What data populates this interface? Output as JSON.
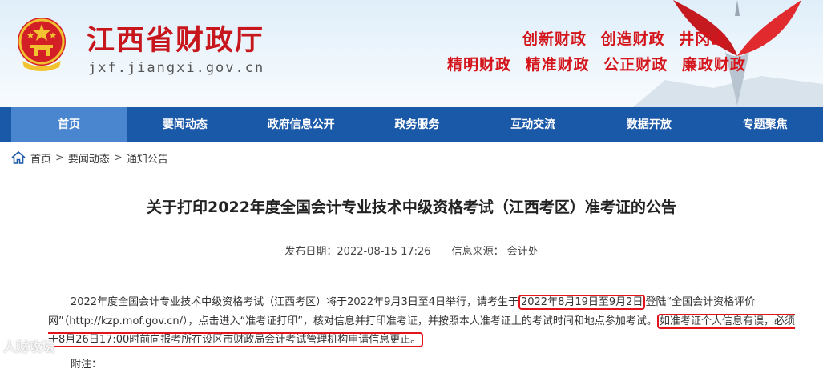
{
  "header": {
    "site_title": "江西省财政厅",
    "site_domain": "jxf.jiangxi.gov.cn",
    "slogans_row1": [
      "创新财政",
      "创造财政",
      "井冈山"
    ],
    "slogans_row2": [
      "精明财政",
      "精准财政",
      "公正财政",
      "廉政财政"
    ]
  },
  "nav": {
    "items": [
      {
        "label": "首页",
        "active": true
      },
      {
        "label": "要闻动态"
      },
      {
        "label": "政府信息公开"
      },
      {
        "label": "政务服务"
      },
      {
        "label": "互动交流"
      },
      {
        "label": "数据开放"
      },
      {
        "label": "专题聚焦"
      }
    ]
  },
  "breadcrumb": {
    "items": [
      "首页",
      "要闻动态",
      "通知公告"
    ],
    "separator": ">"
  },
  "article": {
    "title": "关于打印2022年度全国会计专业技术中级资格考试（江西考区）准考证的公告",
    "publish_label": "发布日期：",
    "publish_date": "2022-08-15 17:26",
    "source_label": "信息来源：",
    "source": "会计处",
    "para_part1": "2022年度全国会计专业技术中级资格考试（江西考区）将于2022年9月3日至4日举行，请考生于",
    "para_highlight1": "2022年8月19日至9月2日",
    "para_part2": "登陆“全国会计资格评价网”（http://kzp.mof.gov.cn/），点击进入“准考证打印”，核对信息并打印准考证，并按照本人准考证上的考试时间和地点参加考试。",
    "para_highlight2": "如准考证个人信息有误，必须于8月26日17:00时前向报考所在设区市财政局会计考试管理机构申请信息更正。",
    "appendix": "附注："
  },
  "watermark": "人财攻坛",
  "colors": {
    "brand_red": "#c8161d",
    "nav_blue": "#1a58a8",
    "nav_active": "#4a86cf",
    "highlight_box": "#e3141b"
  }
}
